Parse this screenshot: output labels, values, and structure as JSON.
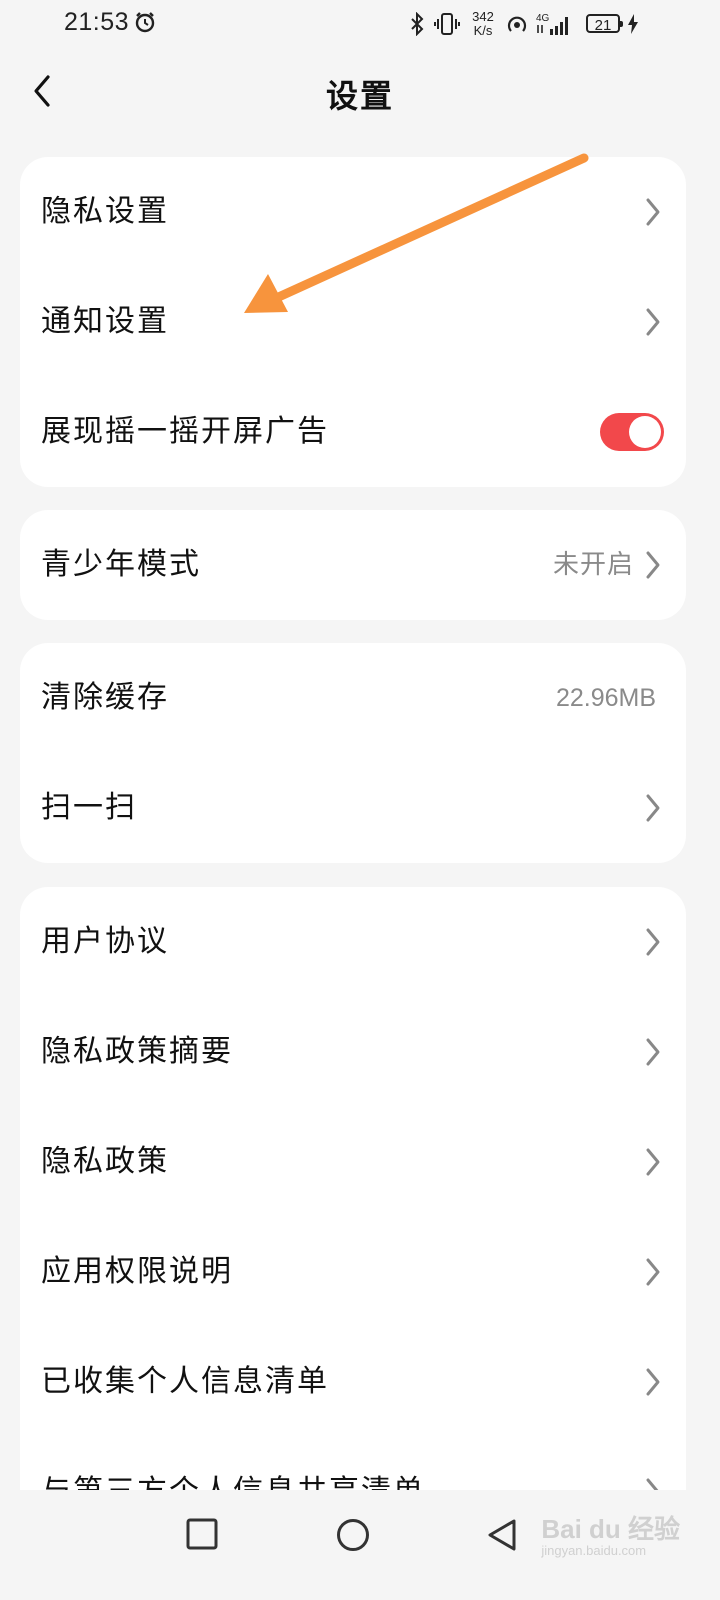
{
  "status_bar": {
    "time": "21:53",
    "net_speed_value": "342",
    "net_speed_unit": "K/s",
    "network": "4G",
    "battery_level": "21",
    "icons": [
      "alarm-icon",
      "bluetooth-icon",
      "vibrate-icon",
      "hotspot-icon",
      "signal-icon",
      "charging-icon"
    ]
  },
  "header": {
    "title": "设置"
  },
  "groups": [
    {
      "items": [
        {
          "label": "隐私设置",
          "control": "chevron"
        },
        {
          "label": "通知设置",
          "control": "chevron"
        },
        {
          "label": "展现摇一摇开屏广告",
          "control": "toggle",
          "toggle_on": true
        }
      ]
    },
    {
      "items": [
        {
          "label": "青少年模式",
          "value": "未开启",
          "control": "chevron"
        }
      ]
    },
    {
      "items": [
        {
          "label": "清除缓存",
          "value": "22.96MB",
          "control": "none"
        },
        {
          "label": "扫一扫",
          "control": "chevron"
        }
      ]
    },
    {
      "items": [
        {
          "label": "用户协议",
          "control": "chevron"
        },
        {
          "label": "隐私政策摘要",
          "control": "chevron"
        },
        {
          "label": "隐私政策",
          "control": "chevron"
        },
        {
          "label": "应用权限说明",
          "control": "chevron"
        },
        {
          "label": "已收集个人信息清单",
          "control": "chevron"
        },
        {
          "label": "与第三方个人信息共享清单",
          "control": "chevron"
        }
      ]
    }
  ],
  "nav_bar": {
    "buttons": [
      "recents-square-icon",
      "home-circle-icon",
      "back-triangle-icon"
    ]
  },
  "watermark": {
    "main": "Bai du 经验",
    "sub": "jingyan.baidu.com"
  },
  "colors": {
    "background": "#f5f5f5",
    "card": "#ffffff",
    "toggle_on": "#f2484b",
    "annotation_arrow": "#f7943d",
    "secondary_text": "#8a8a8a"
  }
}
